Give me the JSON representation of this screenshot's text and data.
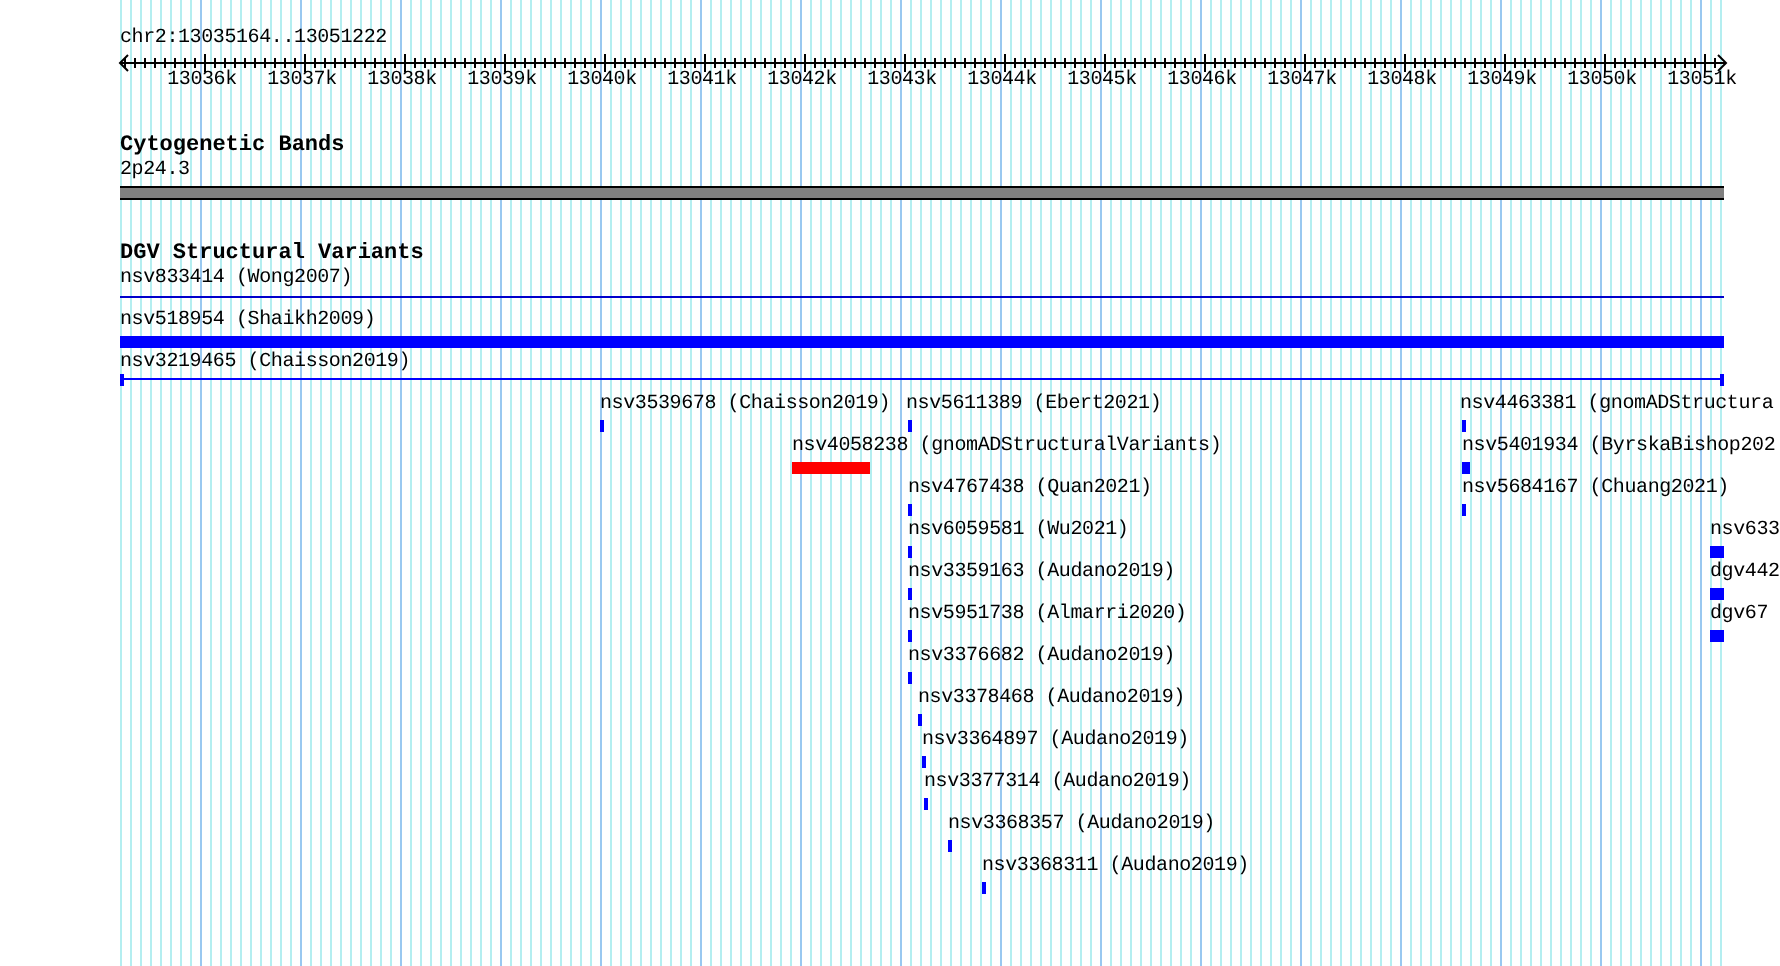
{
  "ruler": {
    "locus": "chr2:13035164..13051222",
    "ticks": [
      "13036k",
      "13037k",
      "13038k",
      "13039k",
      "13040k",
      "13041k",
      "13042k",
      "13043k",
      "13044k",
      "13045k",
      "13046k",
      "13047k",
      "13048k",
      "13049k",
      "13050k",
      "13051k"
    ]
  },
  "cytoband_track": {
    "title": "Cytogenetic Bands",
    "band": "2p24.3"
  },
  "variant_track": {
    "title": "DGV Structural Variants",
    "features": [
      {
        "label": "nsv833414 (Wong2007)",
        "kind": "line",
        "color": "#0000cc"
      },
      {
        "label": "nsv518954 (Shaikh2009)",
        "kind": "bar",
        "color": "#0000ff"
      },
      {
        "label": "nsv3219465 (Chaisson2019)",
        "kind": "span",
        "color": "#0000ff"
      },
      {
        "label": "nsv3539678 (Chaisson2019)",
        "kind": "tick",
        "color": "#0000ff"
      },
      {
        "label": "nsv5611389 (Ebert2021)",
        "kind": "tick",
        "color": "#0000ff"
      },
      {
        "label": "nsv4463381 (gnomADStructura",
        "kind": "tick",
        "color": "#0000ff"
      },
      {
        "label": "nsv4058238 (gnomADStructuralVariants)",
        "kind": "bar",
        "color": "#ff0000"
      },
      {
        "label": "nsv5401934 (ByrskaBishop202",
        "kind": "block",
        "color": "#0000ff"
      },
      {
        "label": "nsv4767438 (Quan2021)",
        "kind": "tick",
        "color": "#0000ff"
      },
      {
        "label": "nsv5684167 (Chuang2021)",
        "kind": "tick",
        "color": "#0000ff"
      },
      {
        "label": "nsv6059581 (Wu2021)",
        "kind": "tick",
        "color": "#0000ff"
      },
      {
        "label": "nsv633",
        "kind": "block",
        "color": "#0000ff"
      },
      {
        "label": "nsv3359163 (Audano2019)",
        "kind": "tick",
        "color": "#0000ff"
      },
      {
        "label": "dgv442",
        "kind": "block",
        "color": "#0000ff"
      },
      {
        "label": "nsv5951738 (Almarri2020)",
        "kind": "tick",
        "color": "#0000ff"
      },
      {
        "label": "dgv67",
        "kind": "block",
        "color": "#0000ff"
      },
      {
        "label": "nsv3376682 (Audano2019)",
        "kind": "tick",
        "color": "#0000ff"
      },
      {
        "label": "nsv3378468 (Audano2019)",
        "kind": "tick",
        "color": "#0000ff"
      },
      {
        "label": "nsv3364897 (Audano2019)",
        "kind": "tick",
        "color": "#0000ff"
      },
      {
        "label": "nsv3377314 (Audano2019)",
        "kind": "tick",
        "color": "#0000ff"
      },
      {
        "label": "nsv3368357 (Audano2019)",
        "kind": "tick",
        "color": "#0000ff"
      },
      {
        "label": "nsv3368311 (Audano2019)",
        "kind": "tick",
        "color": "#0000ff"
      }
    ]
  }
}
